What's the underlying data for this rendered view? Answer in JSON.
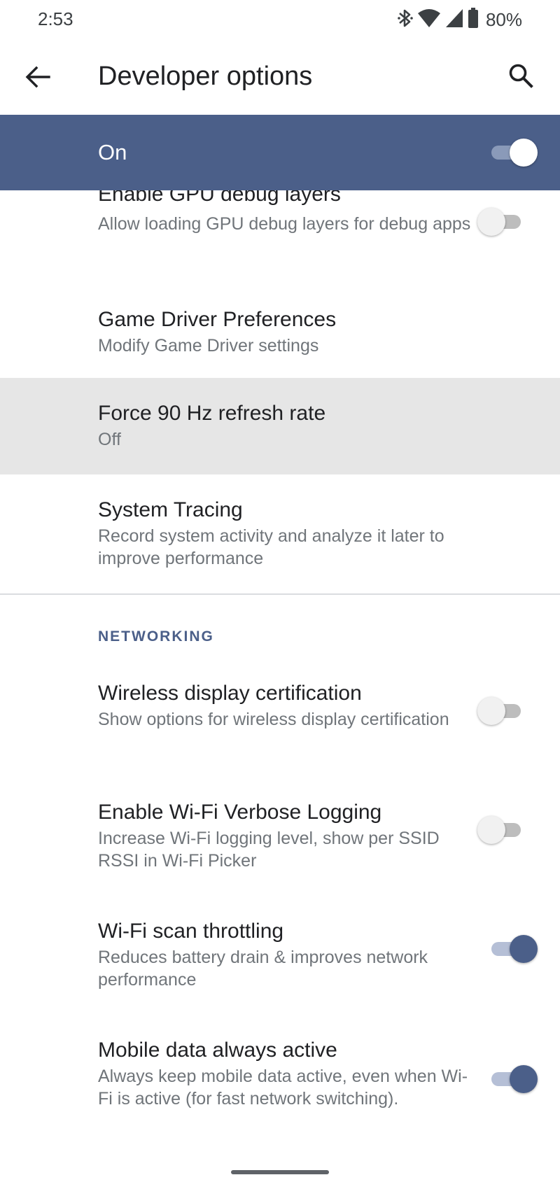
{
  "status_bar": {
    "time": "2:53",
    "battery_percent": "80%",
    "icons": [
      "bluetooth-icon",
      "wifi-icon",
      "cell-signal-icon",
      "battery-icon"
    ]
  },
  "app_bar": {
    "title": "Developer options",
    "back_icon": "arrow-left-icon",
    "search_icon": "search-icon"
  },
  "master_switch": {
    "label": "On",
    "checked": true
  },
  "colors": {
    "accent": "#4b5f89",
    "title_text": "#202124",
    "summary_text": "#70757a",
    "highlight": "#e6e6e6"
  },
  "preferences": [
    {
      "title": "Enable GPU debug layers",
      "summary": "Allow loading GPU debug layers for debug apps",
      "switch": false
    },
    {
      "title": "Game Driver Preferences",
      "summary": "Modify Game Driver settings"
    },
    {
      "title": "Force 90 Hz refresh rate",
      "summary": "Off",
      "highlighted": true
    },
    {
      "title": "System Tracing",
      "summary": "Record system activity and analyze it later to improve performance"
    }
  ],
  "networking": {
    "category": "NETWORKING",
    "items": [
      {
        "title": "Wireless display certification",
        "summary": "Show options for wireless display certification",
        "switch": false
      },
      {
        "title": "Enable Wi-Fi Verbose Logging",
        "summary": "Increase Wi-Fi logging level, show per SSID RSSI in Wi-Fi Picker",
        "switch": false
      },
      {
        "title": "Wi-Fi scan throttling",
        "summary": "Reduces battery drain & improves network performance",
        "switch": true
      },
      {
        "title": "Mobile data always active",
        "summary": "Always keep mobile data active, even when Wi-Fi is active (for fast network switching).",
        "switch": true
      }
    ]
  }
}
